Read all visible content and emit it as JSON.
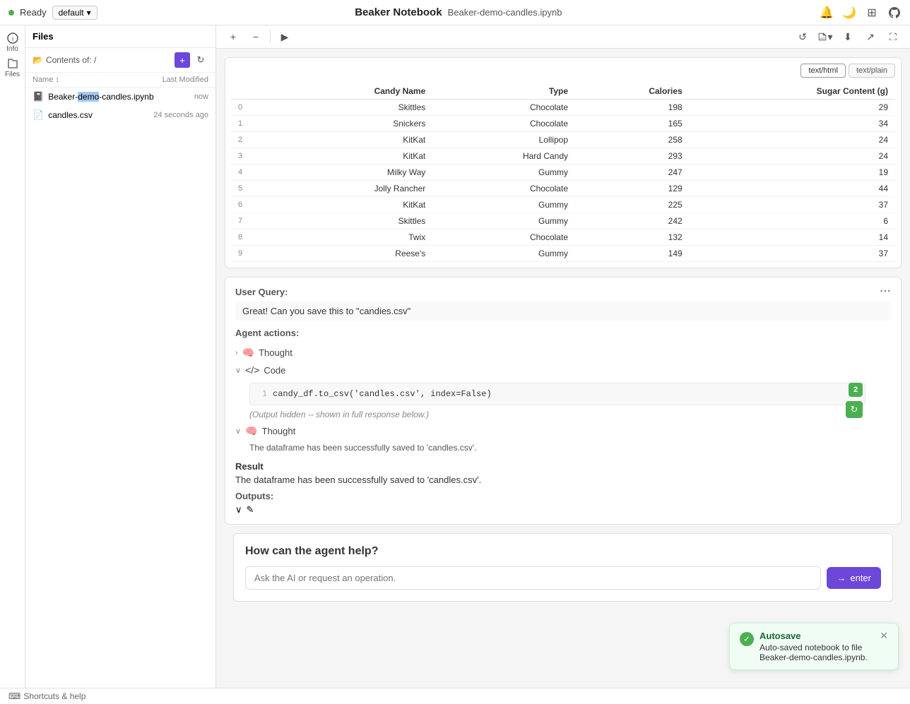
{
  "app": {
    "title": "Beaker Notebook",
    "filename": "Beaker-demo-candles.ipynb",
    "status": "Ready",
    "branch": "default"
  },
  "sidebar": {
    "icons": [
      {
        "name": "info-icon",
        "label": "Info",
        "glyph": "ℹ"
      },
      {
        "name": "files-icon",
        "label": "Files",
        "glyph": "📁"
      }
    ]
  },
  "files_panel": {
    "title": "Files",
    "contents_label": "Contents of: /",
    "columns": {
      "name": "Name",
      "modified": "Last Modified"
    },
    "files": [
      {
        "name": "Beaker-demo-candles.ipynb",
        "modified": "now",
        "type": "notebook",
        "name_parts": [
          "Beaker-",
          "demo",
          "-candles.ipynb"
        ]
      },
      {
        "name": "candles.csv",
        "modified": "24 seconds ago",
        "type": "csv"
      }
    ]
  },
  "notebook_toolbar": {
    "add_label": "+",
    "remove_label": "−",
    "run_label": "▶"
  },
  "table_cell": {
    "tabs": [
      "text/html",
      "text/plain"
    ],
    "active_tab": "text/html",
    "columns": [
      "",
      "Candy Name",
      "Type",
      "Calories",
      "Sugar Content (g)"
    ],
    "rows": [
      {
        "idx": "0",
        "candy_name": "Skittles",
        "type": "Chocolate",
        "calories": 198,
        "sugar": 29
      },
      {
        "idx": "1",
        "candy_name": "Snickers",
        "type": "Chocolate",
        "calories": 165,
        "sugar": 34
      },
      {
        "idx": "2",
        "candy_name": "KitKat",
        "type": "Lollipop",
        "calories": 258,
        "sugar": 24
      },
      {
        "idx": "3",
        "candy_name": "KitKat",
        "type": "Hard Candy",
        "calories": 293,
        "sugar": 24
      },
      {
        "idx": "4",
        "candy_name": "Milky Way",
        "type": "Gummy",
        "calories": 247,
        "sugar": 19
      },
      {
        "idx": "5",
        "candy_name": "Jolly Rancher",
        "type": "Chocolate",
        "calories": 129,
        "sugar": 44
      },
      {
        "idx": "6",
        "candy_name": "KitKat",
        "type": "Gummy",
        "calories": 225,
        "sugar": 37
      },
      {
        "idx": "7",
        "candy_name": "Skittles",
        "type": "Gummy",
        "calories": 242,
        "sugar": 6
      },
      {
        "idx": "8",
        "candy_name": "Twix",
        "type": "Chocolate",
        "calories": 132,
        "sugar": 14
      },
      {
        "idx": "9",
        "candy_name": "Reese's",
        "type": "Gummy",
        "calories": 149,
        "sugar": 37
      }
    ]
  },
  "agent_cell": {
    "user_query_label": "User Query:",
    "user_query_text": "Great! Can you save this to \"candies.csv\"",
    "agent_actions_label": "Agent actions:",
    "thought_label": "Thought",
    "code_label": "Code",
    "code_line": "candy_df.to_csv('candles.csv', index=False)",
    "output_hidden": "(Output hidden -- shown in full response below.)",
    "thought2_text": "The dataframe has been successfully saved to 'candles.csv'.",
    "result_label": "Result",
    "result_text": "The dataframe has been successfully saved to 'candles.csv'.",
    "outputs_label": "Outputs:",
    "code_badge": "2"
  },
  "ask_agent": {
    "title": "How can the agent help?",
    "placeholder": "Ask the AI or request an operation.",
    "button_label": "enter"
  },
  "bottom_bar": {
    "link_label": "Shortcuts & help"
  },
  "autosave_toast": {
    "title": "Autosave",
    "body": "Auto-saved notebook to file Beaker-demo-candles.ipynb."
  }
}
